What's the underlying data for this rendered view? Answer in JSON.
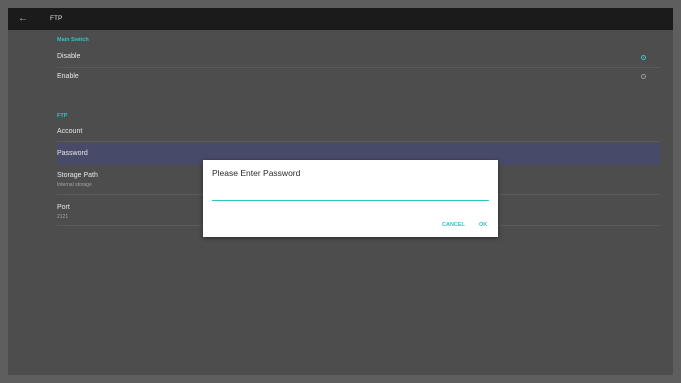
{
  "topbar": {
    "title": "FTP",
    "back_icon": "←"
  },
  "main_switch": {
    "section_label": "Main Switch",
    "options": [
      {
        "label": "Disable",
        "checked": true
      },
      {
        "label": "Enable",
        "checked": false
      }
    ]
  },
  "ftp": {
    "section_label": "FTP",
    "account_label": "Account",
    "password_label": "Password",
    "storage_path_label": "Storage Path",
    "storage_path_value": "Internal storage",
    "port_label": "Port",
    "port_value": "2121"
  },
  "dialog": {
    "title": "Please Enter Password",
    "input_value": "",
    "cancel_label": "CANCEL",
    "ok_label": "OK"
  },
  "colors": {
    "accent": "#2ec5c0",
    "selected_row": "#484a6a",
    "background": "#4d4d4d"
  }
}
